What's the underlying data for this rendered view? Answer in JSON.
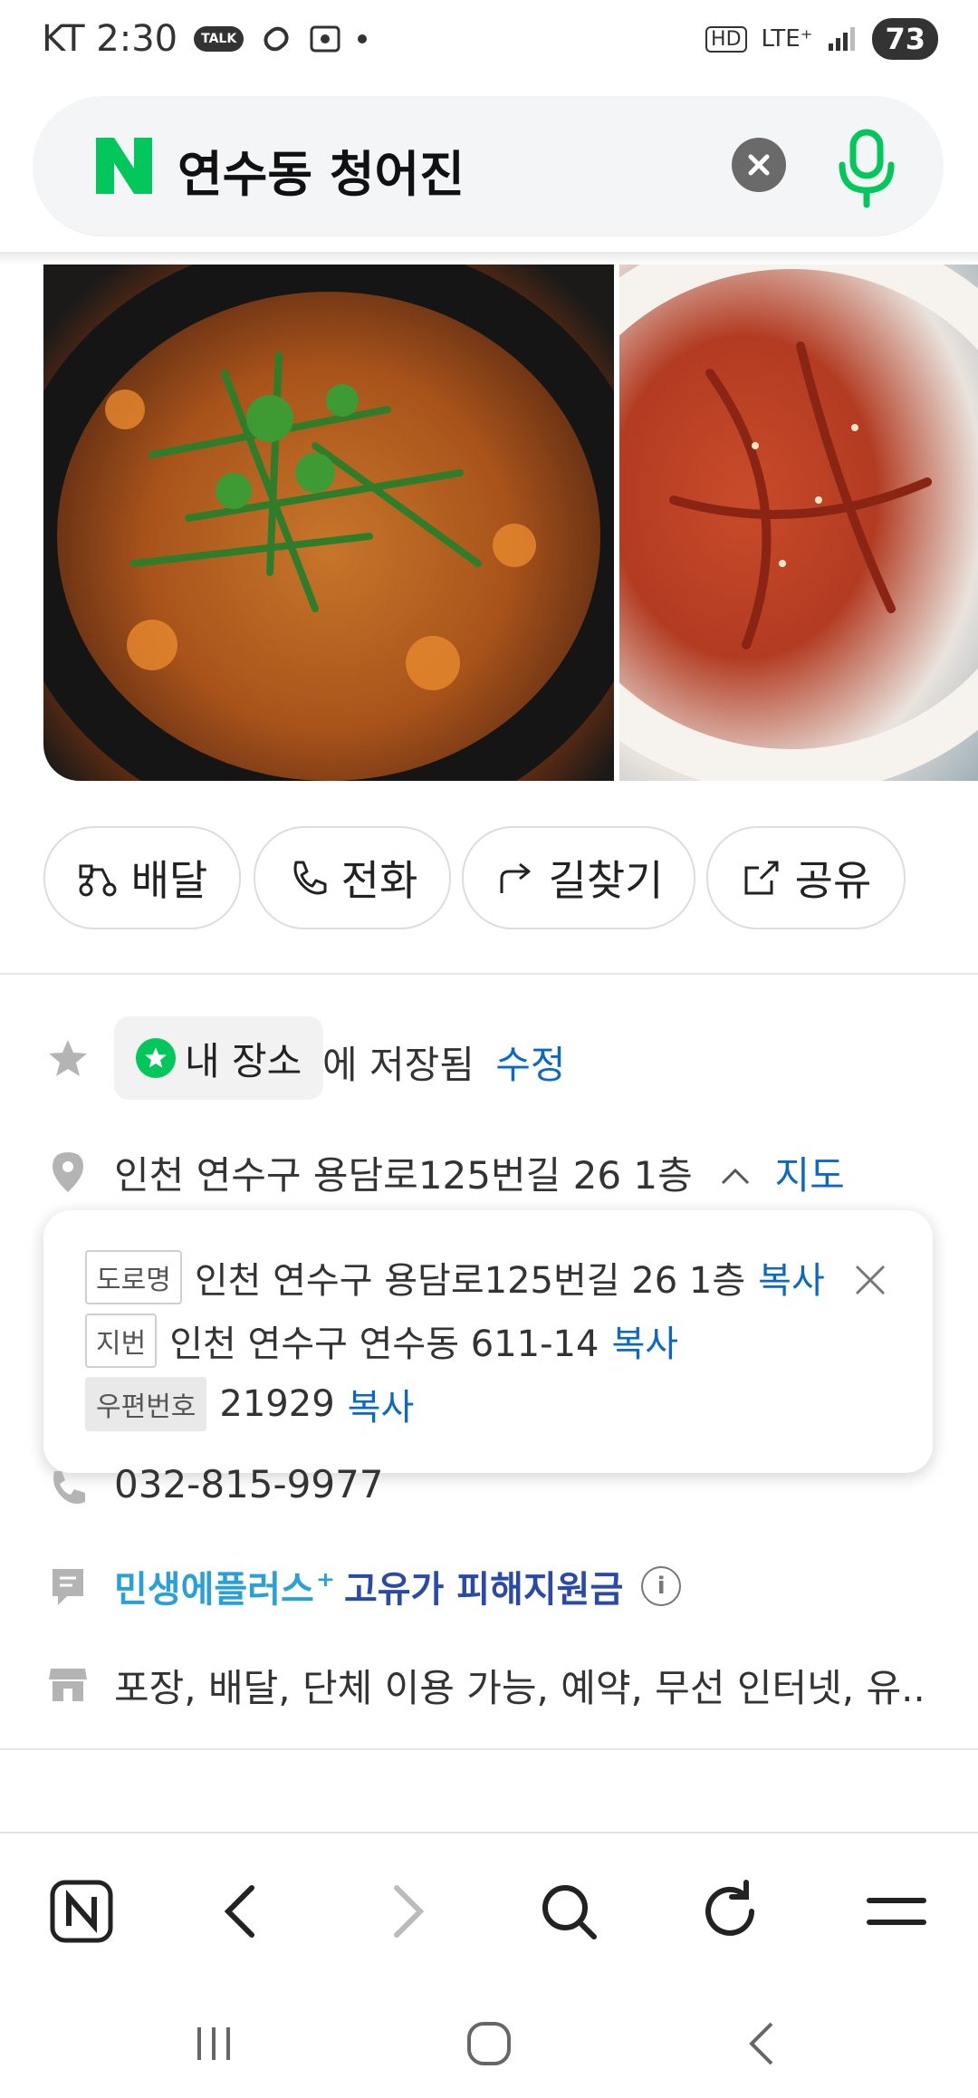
{
  "status_bar": {
    "carrier_time": "KT 2:30",
    "talk_badge": "TALK",
    "network": "LTE⁺",
    "hd": "HD",
    "battery": "73"
  },
  "search": {
    "query": "연수동 청어진",
    "logo_letter": "N"
  },
  "actions": {
    "delivery": "배달",
    "call": "전화",
    "directions": "길찾기",
    "share": "공유"
  },
  "saved": {
    "pill_label": "내 장소",
    "suffix": "에 저장됨",
    "edit": "수정"
  },
  "address": {
    "main": "인천 연수구 용담로125번길 26 1층",
    "map_link": "지도",
    "road_tag": "도로명",
    "road_value": "인천 연수구 용담로125번길 26 1층",
    "lot_tag": "지번",
    "lot_value": "인천 연수구 연수동 611-14",
    "zip_tag": "우편번호",
    "zip_value": "21929",
    "copy": "복사"
  },
  "phone": "032-815-9977",
  "benefit": {
    "part1": "민생에플러스",
    "plus": "⁺",
    "part2": "고유가 피해지원금"
  },
  "services": "포장, 배달, 단체 이용 가능, 예약, 무선 인터넷, 유...",
  "colors": {
    "naver_green": "#03c75a",
    "link_blue": "#0b68c4"
  }
}
